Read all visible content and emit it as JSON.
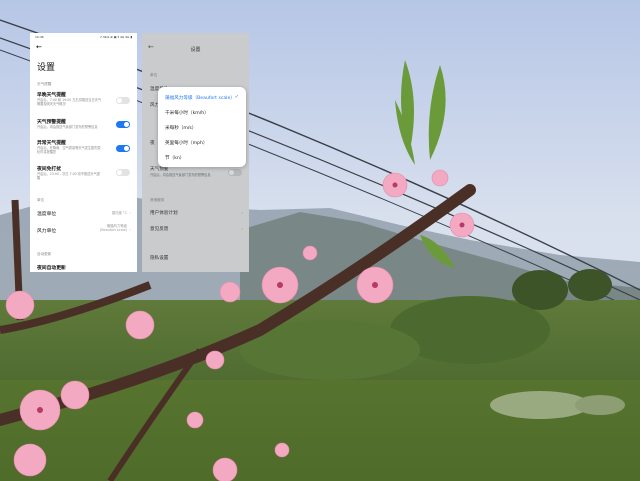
{
  "left_screen": {
    "status_left": "10:46",
    "status_right": "7.3K/s ⊕ ▣ ▾ 4G 4G ▮",
    "title": "设置",
    "section_weather_alerts": "天气提醒",
    "items": [
      {
        "title": "早晚天气提醒",
        "desc": "开启后，7:00 和 19:00 左右将推送当日天气概要及明天天气概况",
        "enabled": false
      },
      {
        "title": "天气预警提醒",
        "desc": "开启后，将会推送气象部门发布的预警信息",
        "enabled": true
      },
      {
        "title": "异常天气提醒",
        "desc": "开启后，在降雨、空气质量等天气发生剧烈变化时将提醒您",
        "enabled": true
      },
      {
        "title": "夜间免打扰",
        "desc": "开启后，23:00 - 次日 7:00 将不推送天气提醒",
        "enabled": false
      }
    ],
    "section_units": "单位",
    "temperature_unit_label": "温度单位",
    "temperature_unit_value": "摄氏度 °C",
    "wind_unit_label": "风力单位",
    "wind_unit_value": "蒲福风力等级\n(Beaufort scale)",
    "section_updates": "自动更新",
    "night_update_label": "夜间自动更新"
  },
  "right_screen": {
    "title": "设置",
    "section_units": "单位",
    "temperature_row": "温度单位",
    "wind_row": "风力单位",
    "partial_row": "夜",
    "night_row": "天气预警",
    "night_desc": "开启后，将会推送气象部门发布的预警信息",
    "section_other": "其他服务",
    "user_experience": "用户体验计划",
    "feedback": "意见反馈",
    "about": "隐私设置"
  },
  "dropdown": {
    "options": [
      {
        "label": "蒲福风力等级（Beaufort scale）",
        "selected": true
      },
      {
        "label": "千米每小时（km/h）",
        "selected": false
      },
      {
        "label": "米每秒（m/s）",
        "selected": false
      },
      {
        "label": "英里每小时（mph）",
        "selected": false
      },
      {
        "label": "节（kn）",
        "selected": false
      }
    ],
    "check": "✓"
  },
  "colors": {
    "accent": "#1e78f0",
    "sky": "#c8d6ec",
    "blossom": "#f0a3bd",
    "leaf": "#5f8a35"
  }
}
